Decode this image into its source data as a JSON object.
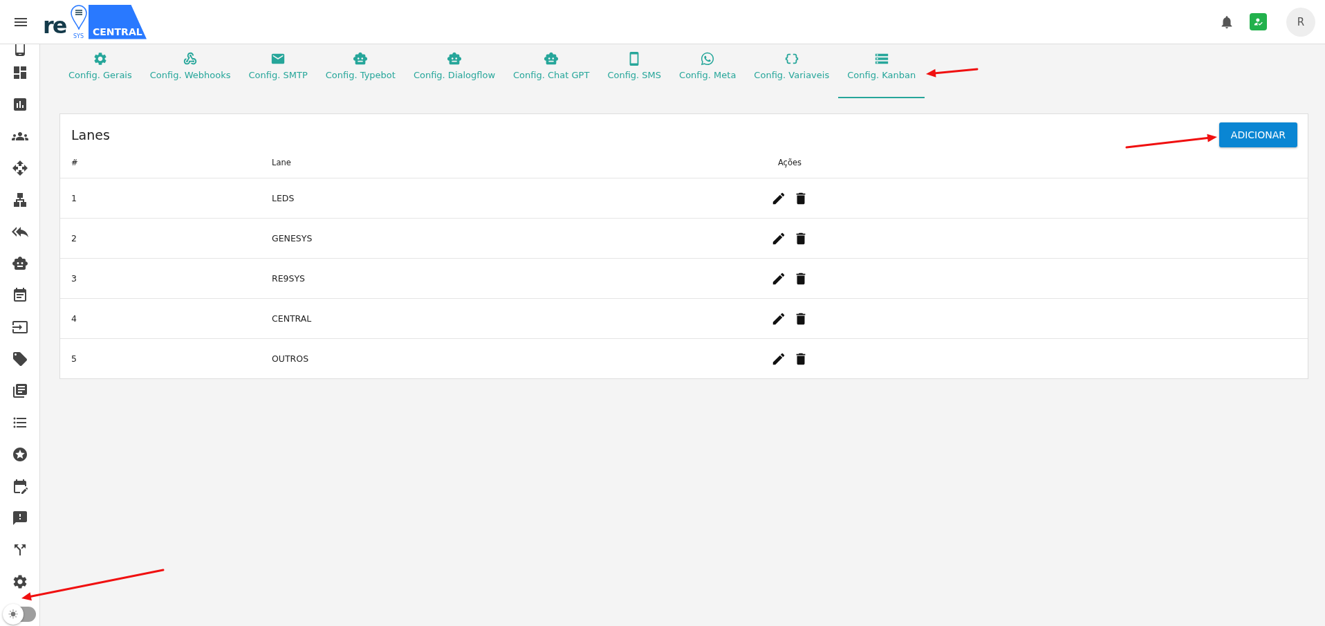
{
  "logo": {
    "mark": "re",
    "sub": "SYS",
    "badge": "CENTRAL"
  },
  "header": {
    "avatar": "R"
  },
  "tabs": [
    {
      "label": "Config. Gerais",
      "selected": false
    },
    {
      "label": "Config. Webhooks",
      "selected": false
    },
    {
      "label": "Config. SMTP",
      "selected": false
    },
    {
      "label": "Config. Typebot",
      "selected": false
    },
    {
      "label": "Config. Dialogflow",
      "selected": false
    },
    {
      "label": "Config. Chat GPT",
      "selected": false
    },
    {
      "label": "Config. SMS",
      "selected": false
    },
    {
      "label": "Config. Meta",
      "selected": false
    },
    {
      "label": "Config. Variaveis",
      "selected": false
    },
    {
      "label": "Config. Kanban",
      "selected": true
    }
  ],
  "lanes": {
    "title": "Lanes",
    "add_button": "ADICIONAR",
    "columns": [
      "#",
      "Lane",
      "Ações"
    ],
    "rows": [
      {
        "number": "1",
        "lane": "LEDS"
      },
      {
        "number": "2",
        "lane": "GENESYS"
      },
      {
        "number": "3",
        "lane": "RE9SYS"
      },
      {
        "number": "4",
        "lane": "CENTRAL"
      },
      {
        "number": "5",
        "lane": "OUTROS"
      }
    ]
  },
  "theme_toggle": {
    "on": false
  }
}
